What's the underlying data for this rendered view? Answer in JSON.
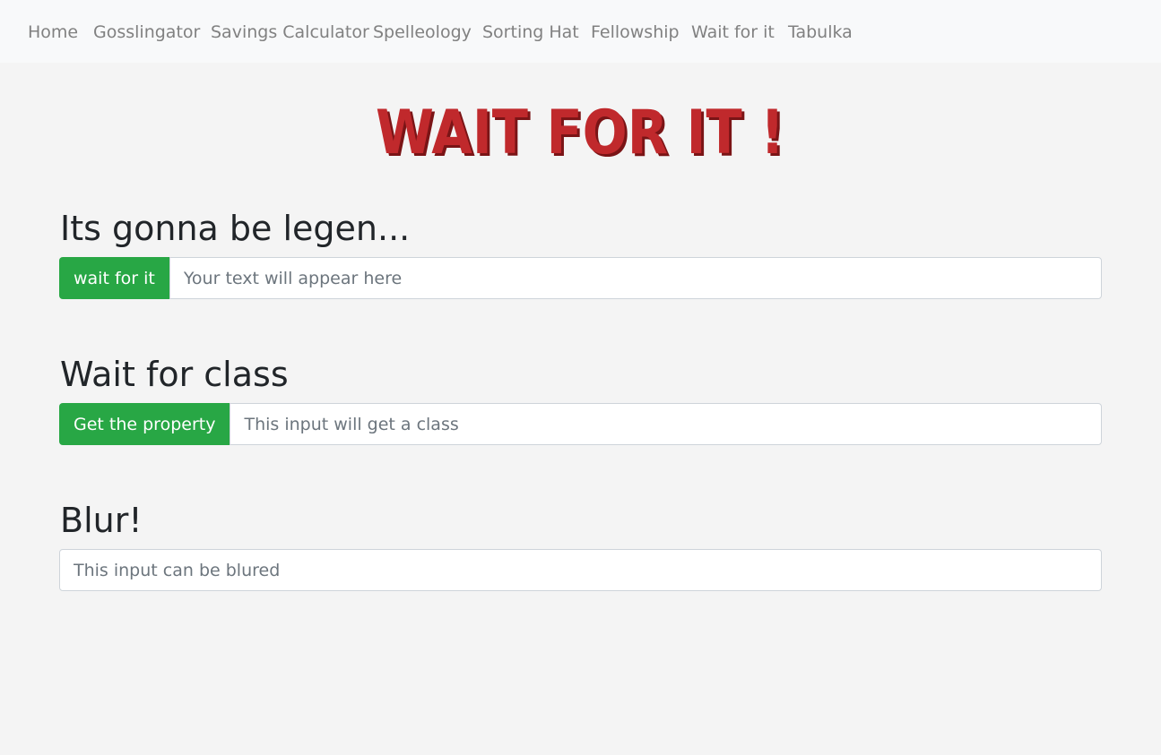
{
  "nav": {
    "items": [
      {
        "label": "Home"
      },
      {
        "label": "Gosslingator"
      },
      {
        "label": "Savings Calculator"
      },
      {
        "label": "Spelleology"
      },
      {
        "label": "Sorting Hat"
      },
      {
        "label": "Fellowship"
      },
      {
        "label": "Wait for it"
      },
      {
        "label": "Tabulka"
      }
    ]
  },
  "logo": {
    "text": "WAIT FOR IT !",
    "color": "#c0292c"
  },
  "sections": [
    {
      "heading": "Its gonna be legen...",
      "button_label": "wait for it",
      "input_placeholder": "Your text will appear here"
    },
    {
      "heading": "Wait for class",
      "button_label": "Get the property",
      "input_placeholder": "This input will get a class"
    },
    {
      "heading": "Blur!",
      "input_placeholder": "This input can be blured"
    }
  ],
  "colors": {
    "button": "#28a745",
    "navbar": "#f8f9fa",
    "background": "#f4f4f4"
  }
}
